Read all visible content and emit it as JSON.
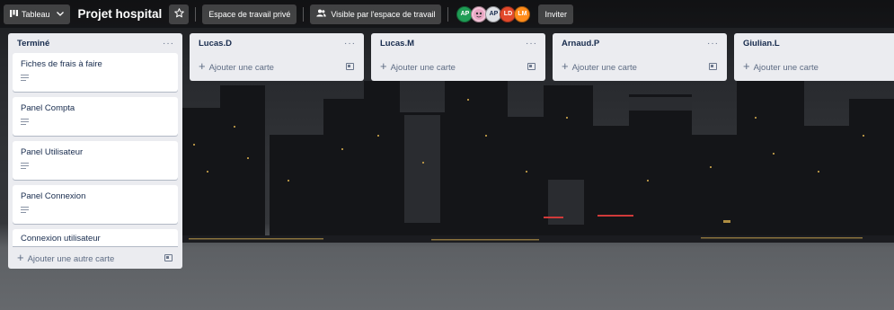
{
  "colors": {
    "list_bg": "#ebecf0",
    "header_overlay": "rgba(0,0,0,0.35)",
    "avatar_green": "#1f9d55",
    "avatar_purple": "#7b5ea7",
    "avatar_red": "#e2492b",
    "avatar_orange": "#ff8c1a"
  },
  "header": {
    "board_button": {
      "icon": "board-icon",
      "label": "Tableau",
      "chevron": "chevron-down-icon"
    },
    "board_title": "Projet hospital",
    "star_icon": "star-icon",
    "workspace_label": "Espace de travail privé",
    "visibility_icon": "people-icon",
    "visibility_label": "Visible par l'espace de travail",
    "members": [
      {
        "initials": "AP",
        "color": "#1f9d55"
      },
      {
        "initials": "",
        "color": "#7b5ea7",
        "kind": "image-avatar"
      },
      {
        "initials": "AP",
        "color": "#dfe1e6"
      },
      {
        "initials": "LD",
        "color": "#e2492b"
      },
      {
        "initials": "LM",
        "color": "#ff8c1a"
      }
    ],
    "invite_label": "Inviter"
  },
  "lists": [
    {
      "title": "Terminé",
      "menu": "···",
      "cards": [
        {
          "title": "Fiches de frais à faire",
          "has_description": true
        },
        {
          "title": "Panel Compta",
          "has_description": true
        },
        {
          "title": "Panel Utilisateur",
          "has_description": true
        },
        {
          "title": "Panel Connexion",
          "has_description": true
        },
        {
          "title": "Connexion utilisateur",
          "has_description": false
        }
      ],
      "add_label": "Ajouter une autre carte"
    },
    {
      "title": "Lucas.D",
      "menu": "···",
      "cards": [],
      "add_label": "Ajouter une carte"
    },
    {
      "title": "Lucas.M",
      "menu": "···",
      "cards": [],
      "add_label": "Ajouter une carte"
    },
    {
      "title": "Arnaud.P",
      "menu": "···",
      "cards": [],
      "add_label": "Ajouter une carte"
    },
    {
      "title": "Giulian.L",
      "menu": "···",
      "cards": [],
      "add_label": "Ajouter une carte"
    }
  ]
}
